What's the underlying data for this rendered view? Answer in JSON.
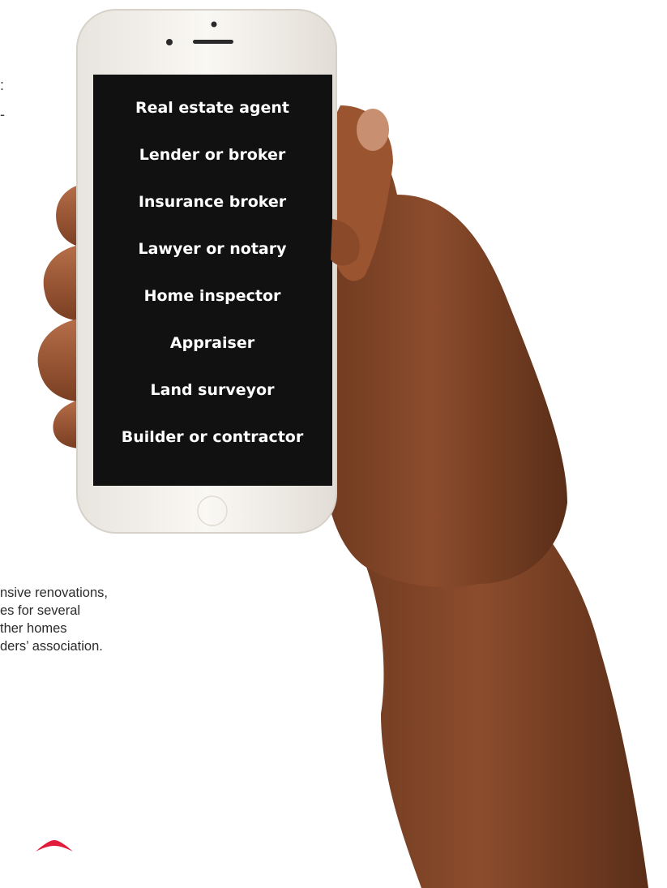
{
  "phone": {
    "items": [
      "Real estate agent",
      "Lender or broker",
      "Insurance broker",
      "Lawyer or notary",
      "Home inspector",
      "Appraiser",
      "Land surveyor",
      "Builder or contractor"
    ]
  },
  "text_fragments": {
    "top_char_1": ":",
    "top_char_2": "-"
  },
  "body_lines": [
    "nsive renovations,",
    "es for several",
    "ther homes",
    "ders’ association."
  ],
  "colors": {
    "chevron": "#e31b3b",
    "screen": "#111111",
    "phone_body": "#f4f1ec",
    "skin": "#8a4a2a"
  },
  "icons": {
    "scroll_top": "chevron-up-icon"
  }
}
